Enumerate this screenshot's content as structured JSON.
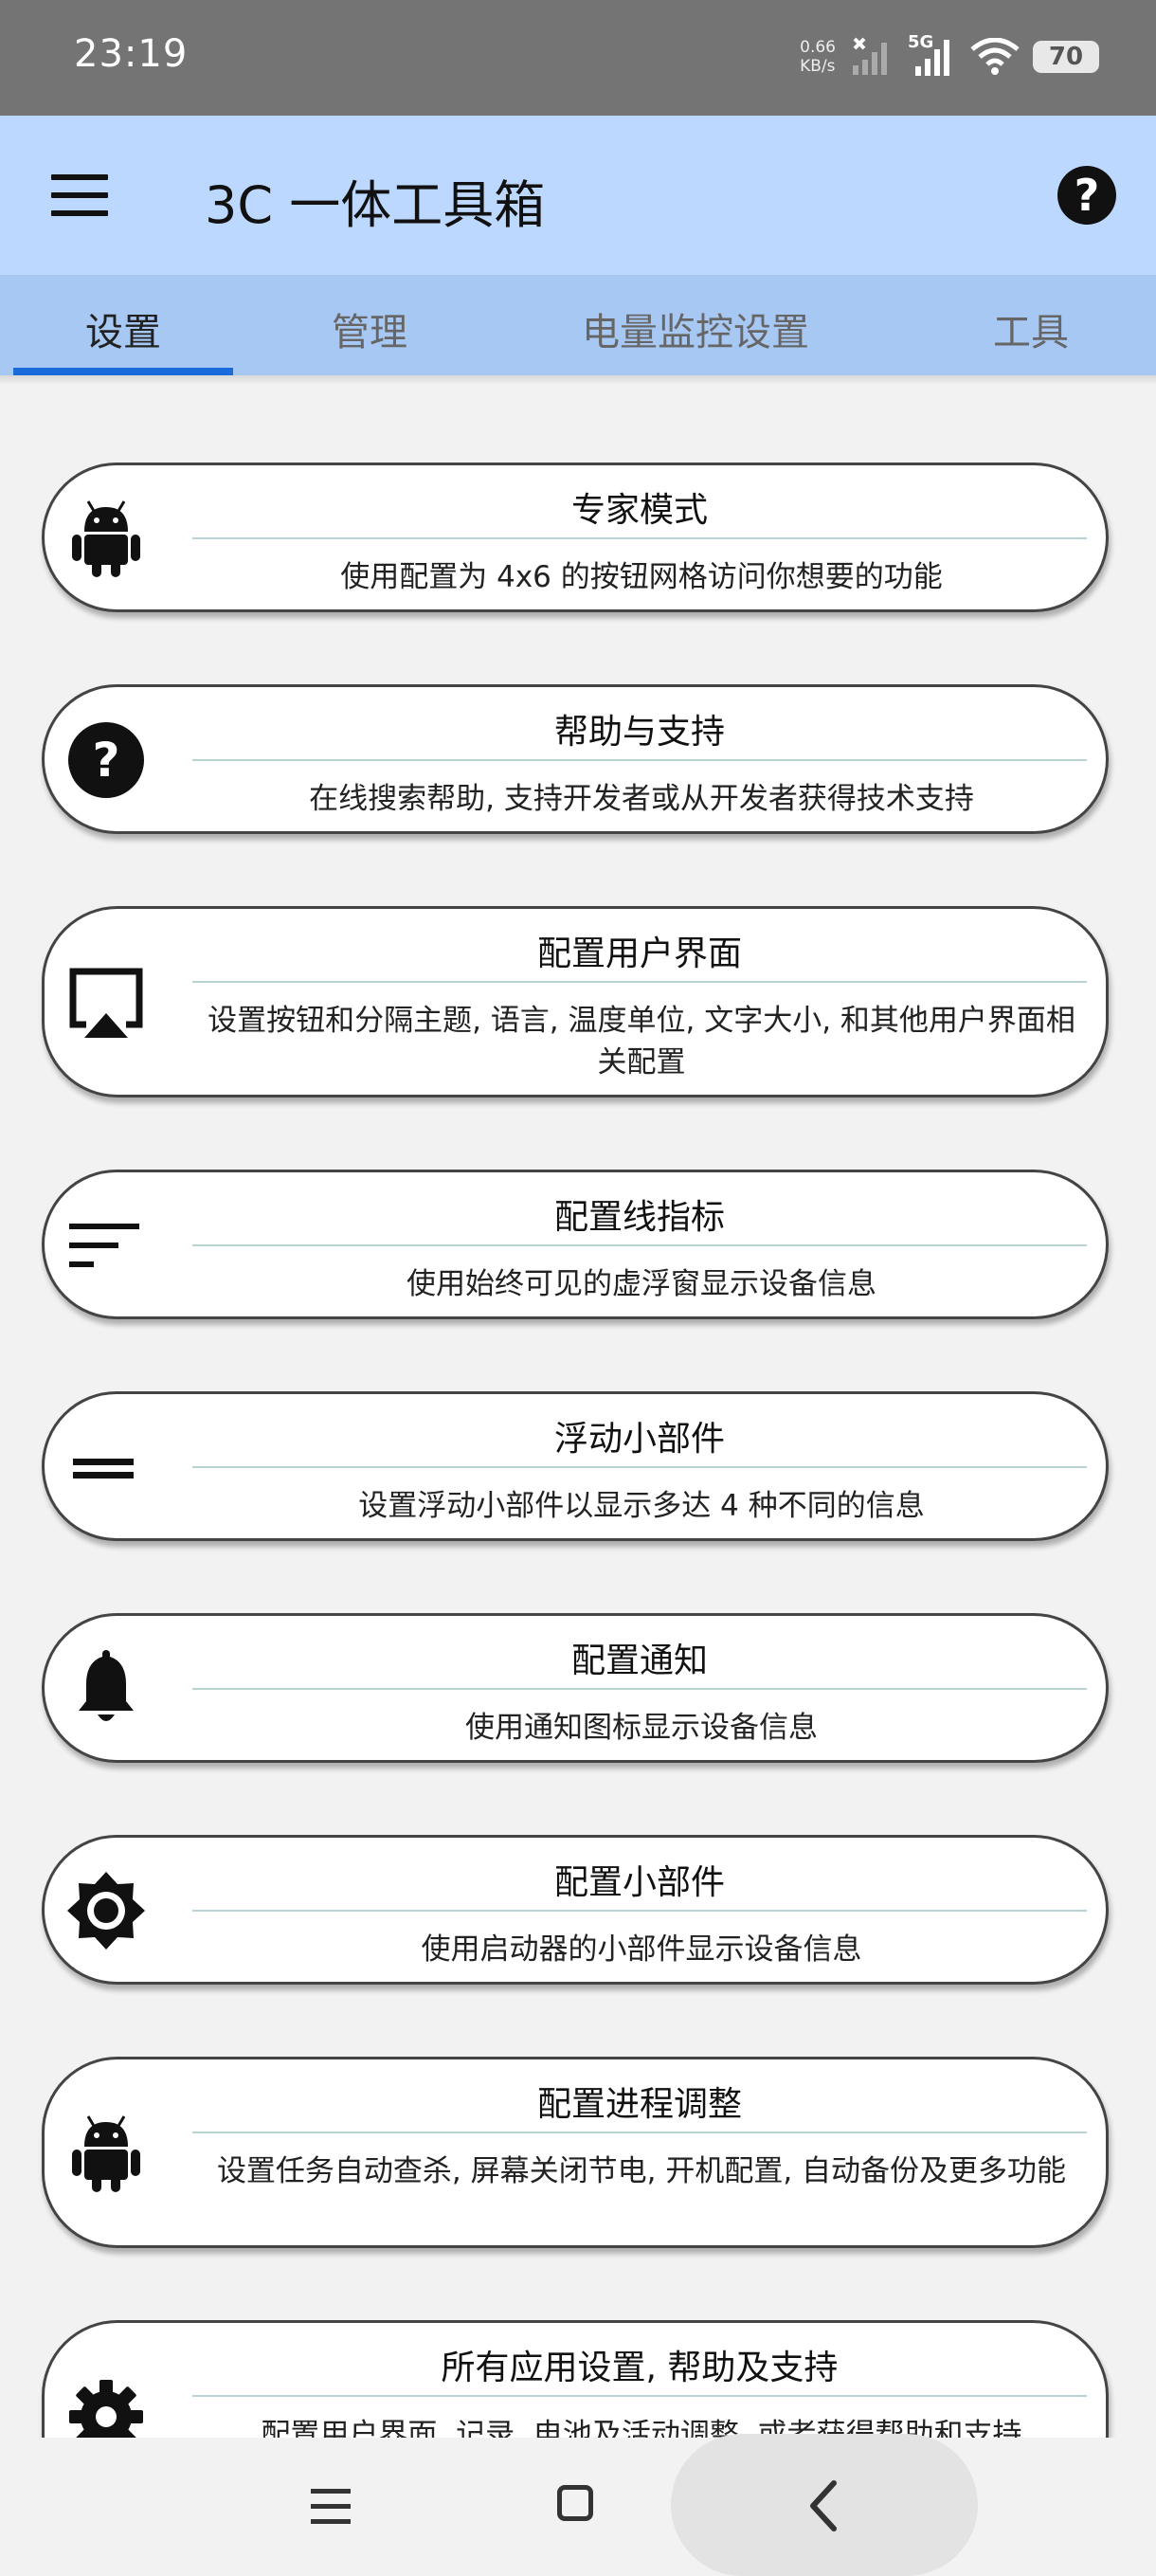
{
  "status_bar": {
    "time": "23:19",
    "net_speed_value": "0.66",
    "net_speed_unit": "KB/s",
    "network_type": "5G",
    "battery_level": "70"
  },
  "app_bar": {
    "title": "3C 一体工具箱"
  },
  "tabs": [
    {
      "label": "设置",
      "active": true
    },
    {
      "label": "管理",
      "active": false
    },
    {
      "label": "电量监控设置",
      "active": false
    },
    {
      "label": "工具",
      "active": false
    }
  ],
  "settings_items": [
    {
      "icon": "android-icon",
      "title": "专家模式",
      "description": "使用配置为 4x6 的按钮网格访问你想要的功能"
    },
    {
      "icon": "help-circle-icon",
      "title": "帮助与支持",
      "description": "在线搜索帮助, 支持开发者或从开发者获得技术支持"
    },
    {
      "icon": "cast-screen-icon",
      "title": "配置用户界面",
      "description": "设置按钮和分隔主题, 语言, 温度单位, 文字大小, 和其他用户界面相关配置"
    },
    {
      "icon": "sort-lines-icon",
      "title": "配置线指标",
      "description": "使用始终可见的虚浮窗显示设备信息"
    },
    {
      "icon": "equals-icon",
      "title": "浮动小部件",
      "description": "设置浮动小部件以显示多达 4 种不同的信息"
    },
    {
      "icon": "bell-icon",
      "title": "配置通知",
      "description": "使用通知图标显示设备信息"
    },
    {
      "icon": "brightness-icon",
      "title": "配置小部件",
      "description": "使用启动器的小部件显示设备信息"
    },
    {
      "icon": "android-icon",
      "title": "配置进程调整",
      "description": "设置任务自动查杀, 屏幕关闭节电, 开机配置, 自动备份及更多功能"
    },
    {
      "icon": "gear-icon",
      "title": "所有应用设置, 帮助及支持",
      "description": "配置用户界面, 记录, 电池及活动调整, 或者获得帮助和支持"
    }
  ]
}
